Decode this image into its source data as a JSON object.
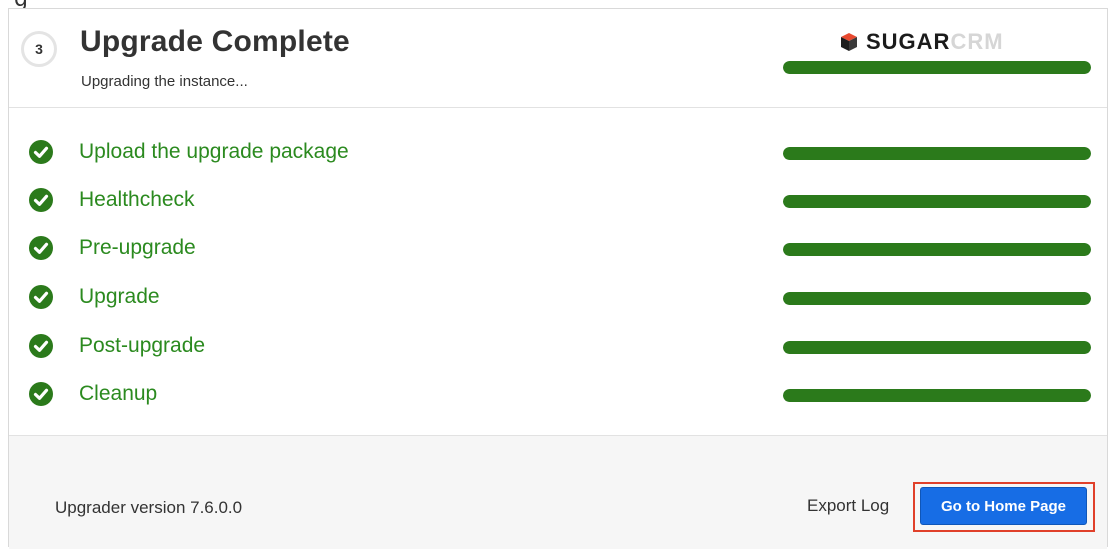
{
  "header": {
    "step_number": "3",
    "title": "Upgrade Complete",
    "subtitle": "Upgrading the instance...",
    "overall_progress": 1.0
  },
  "logo": {
    "sugar": "SUGAR",
    "crm": "CRM"
  },
  "steps": [
    {
      "label": "Upload the upgrade package",
      "status": "complete",
      "progress": 1.0
    },
    {
      "label": "Healthcheck",
      "status": "complete",
      "progress": 1.0
    },
    {
      "label": "Pre-upgrade",
      "status": "complete",
      "progress": 1.0
    },
    {
      "label": "Upgrade",
      "status": "complete",
      "progress": 1.0
    },
    {
      "label": "Post-upgrade",
      "status": "complete",
      "progress": 1.0
    },
    {
      "label": "Cleanup",
      "status": "complete",
      "progress": 1.0
    }
  ],
  "footer": {
    "version_text": "Upgrader version 7.6.0.0",
    "export_log_label": "Export Log",
    "home_button_label": "Go to Home Page"
  },
  "colors": {
    "success_green": "#2b7a1b",
    "primary_button": "#176de5",
    "highlight_outline": "#e0402a"
  },
  "icons": {
    "step_status": "check-circle-icon",
    "logo": "sugar-cube-icon"
  }
}
